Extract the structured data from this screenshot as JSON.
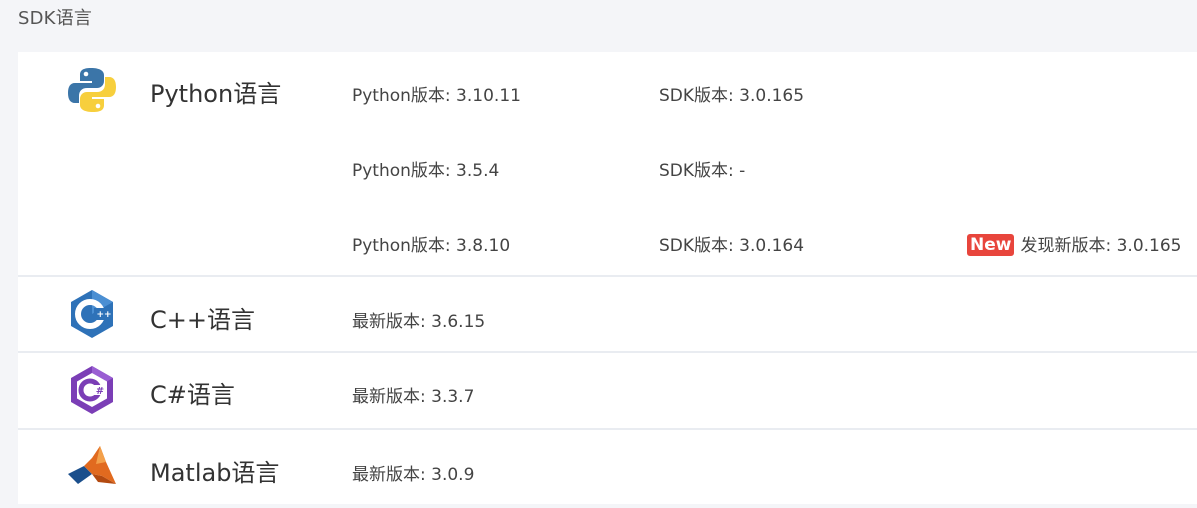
{
  "section": {
    "title": "SDK语言"
  },
  "languages": [
    {
      "name": "Python语言",
      "icon": "python-logo",
      "versions": [
        {
          "lang_version": "Python版本: 3.10.11",
          "sdk_version": "SDK版本: 3.0.165"
        },
        {
          "lang_version": "Python版本: 3.5.4",
          "sdk_version": "SDK版本: -"
        },
        {
          "lang_version": "Python版本: 3.8.10",
          "sdk_version": "SDK版本: 3.0.164",
          "badge": "New",
          "update_text": "发现新版本: 3.0.165"
        }
      ]
    },
    {
      "name": "C++语言",
      "icon": "cpp-logo",
      "latest": "最新版本: 3.6.15"
    },
    {
      "name": "C#语言",
      "icon": "csharp-logo",
      "latest": "最新版本: 3.3.7"
    },
    {
      "name": "Matlab语言",
      "icon": "matlab-logo",
      "latest": "最新版本: 3.0.9"
    }
  ],
  "colors": {
    "page_bg": "#f4f5f8",
    "card_bg": "#ffffff",
    "divider": "#e9ecf1",
    "new_badge": "#e8453c",
    "python_blue": "#3b75a8",
    "python_yellow": "#f7cf3d",
    "cpp_blue": "#2e72b8",
    "csharp_purple": "#7b3eb6",
    "matlab_orange": "#e16a1f"
  }
}
